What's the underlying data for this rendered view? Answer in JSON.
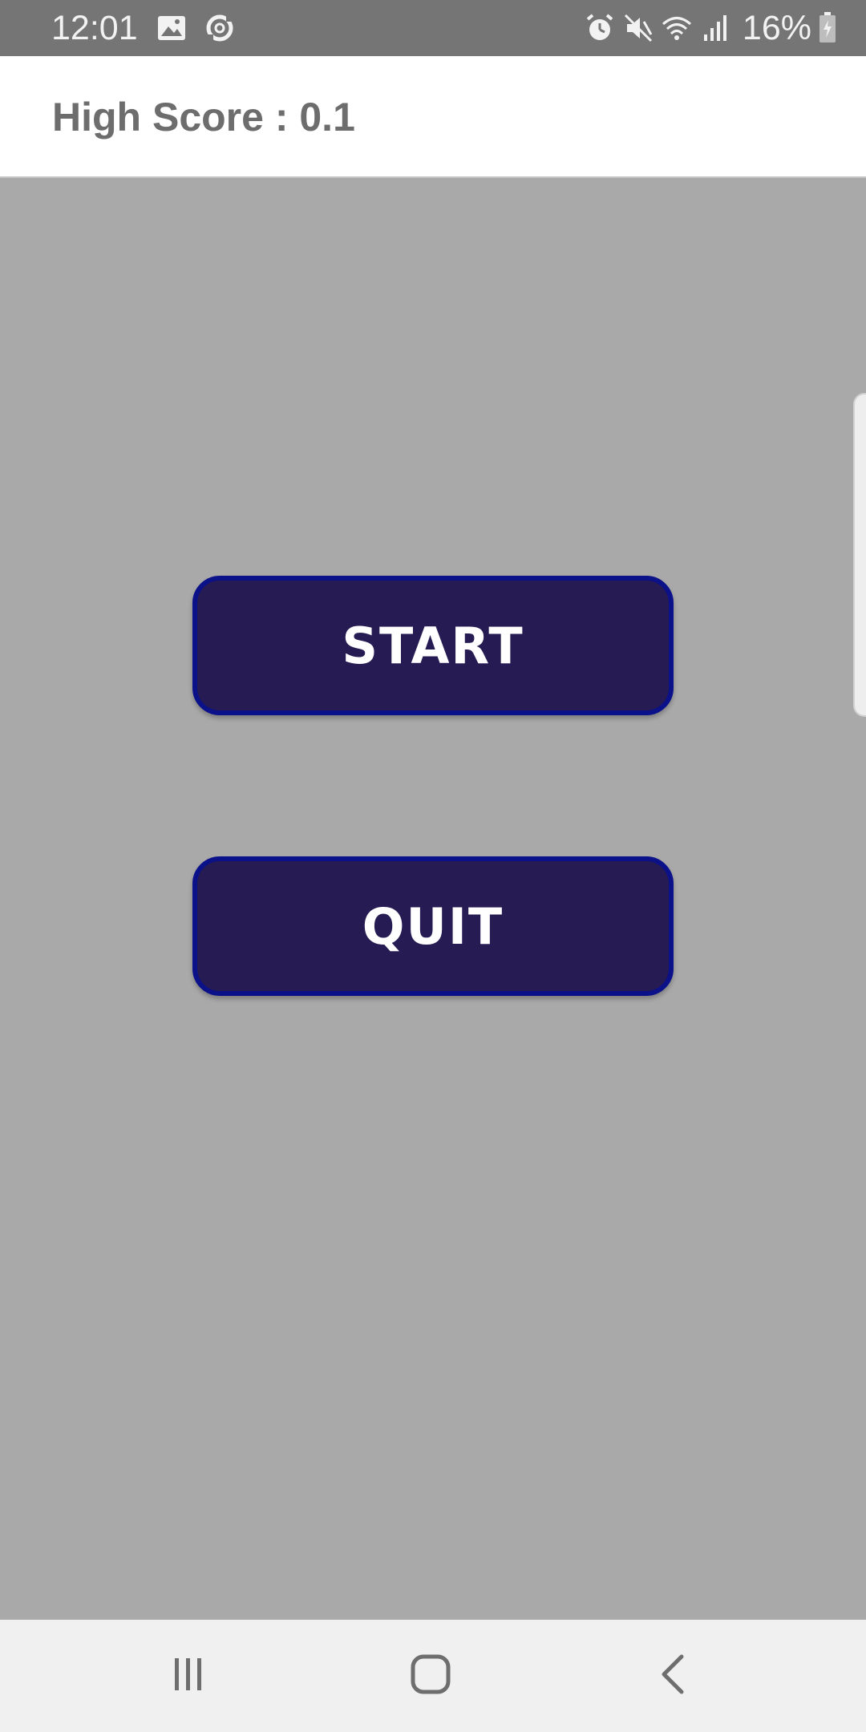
{
  "status_bar": {
    "time": "12:01",
    "battery_percent": "16%",
    "left_icons": [
      "image-icon",
      "sync-icon"
    ],
    "right_icons": [
      "alarm-icon",
      "mute-icon",
      "wifi-icon",
      "signal-icon",
      "battery-icon"
    ]
  },
  "header": {
    "high_score": "High Score : 0.1"
  },
  "menu": {
    "start_label": "START",
    "quit_label": "QUIT"
  },
  "nav_bar": {
    "icons": [
      "recent-apps-icon",
      "home-icon",
      "back-icon"
    ]
  },
  "colors": {
    "background": "#a9a9a9",
    "button_fill": "#261b52",
    "button_border": "#0b1189",
    "status_bar": "#757575"
  }
}
